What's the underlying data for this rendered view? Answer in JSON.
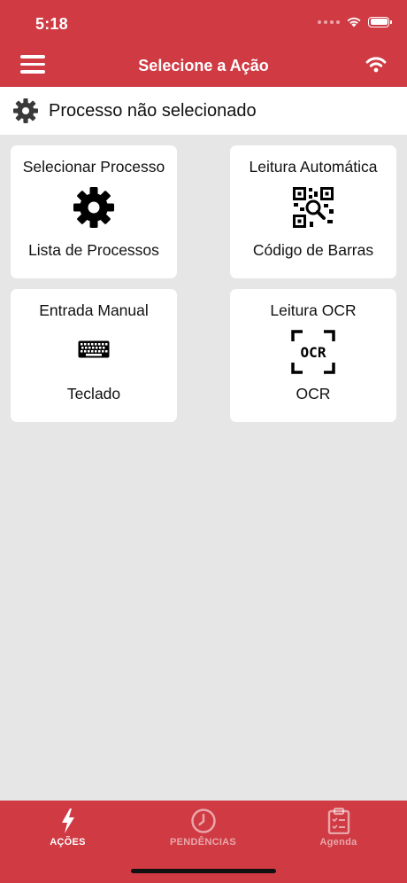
{
  "status_bar": {
    "time": "5:18"
  },
  "header": {
    "title": "Selecione a Ação"
  },
  "process_bar": {
    "label": "Processo não selecionado"
  },
  "cards": [
    {
      "top": "Selecionar Processo",
      "bottom": "Lista de Processos",
      "icon": "gear-icon"
    },
    {
      "top": "Leitura Automática",
      "bottom": "Código de Barras",
      "icon": "qr-scan-icon"
    },
    {
      "top": "Entrada Manual",
      "bottom": "Teclado",
      "icon": "keyboard-icon"
    },
    {
      "top": "Leitura OCR",
      "bottom": "OCR",
      "icon": "ocr-icon",
      "icon_text": "OCR"
    }
  ],
  "tabs": [
    {
      "label": "AÇÕES",
      "icon": "lightning-icon",
      "active": true
    },
    {
      "label": "PENDÊNCIAS",
      "icon": "clock-icon",
      "active": false
    },
    {
      "label": "Agenda",
      "icon": "clipboard-icon",
      "active": false
    }
  ],
  "colors": {
    "accent": "#cf3a43",
    "background": "#e6e6e6",
    "card": "#ffffff"
  }
}
